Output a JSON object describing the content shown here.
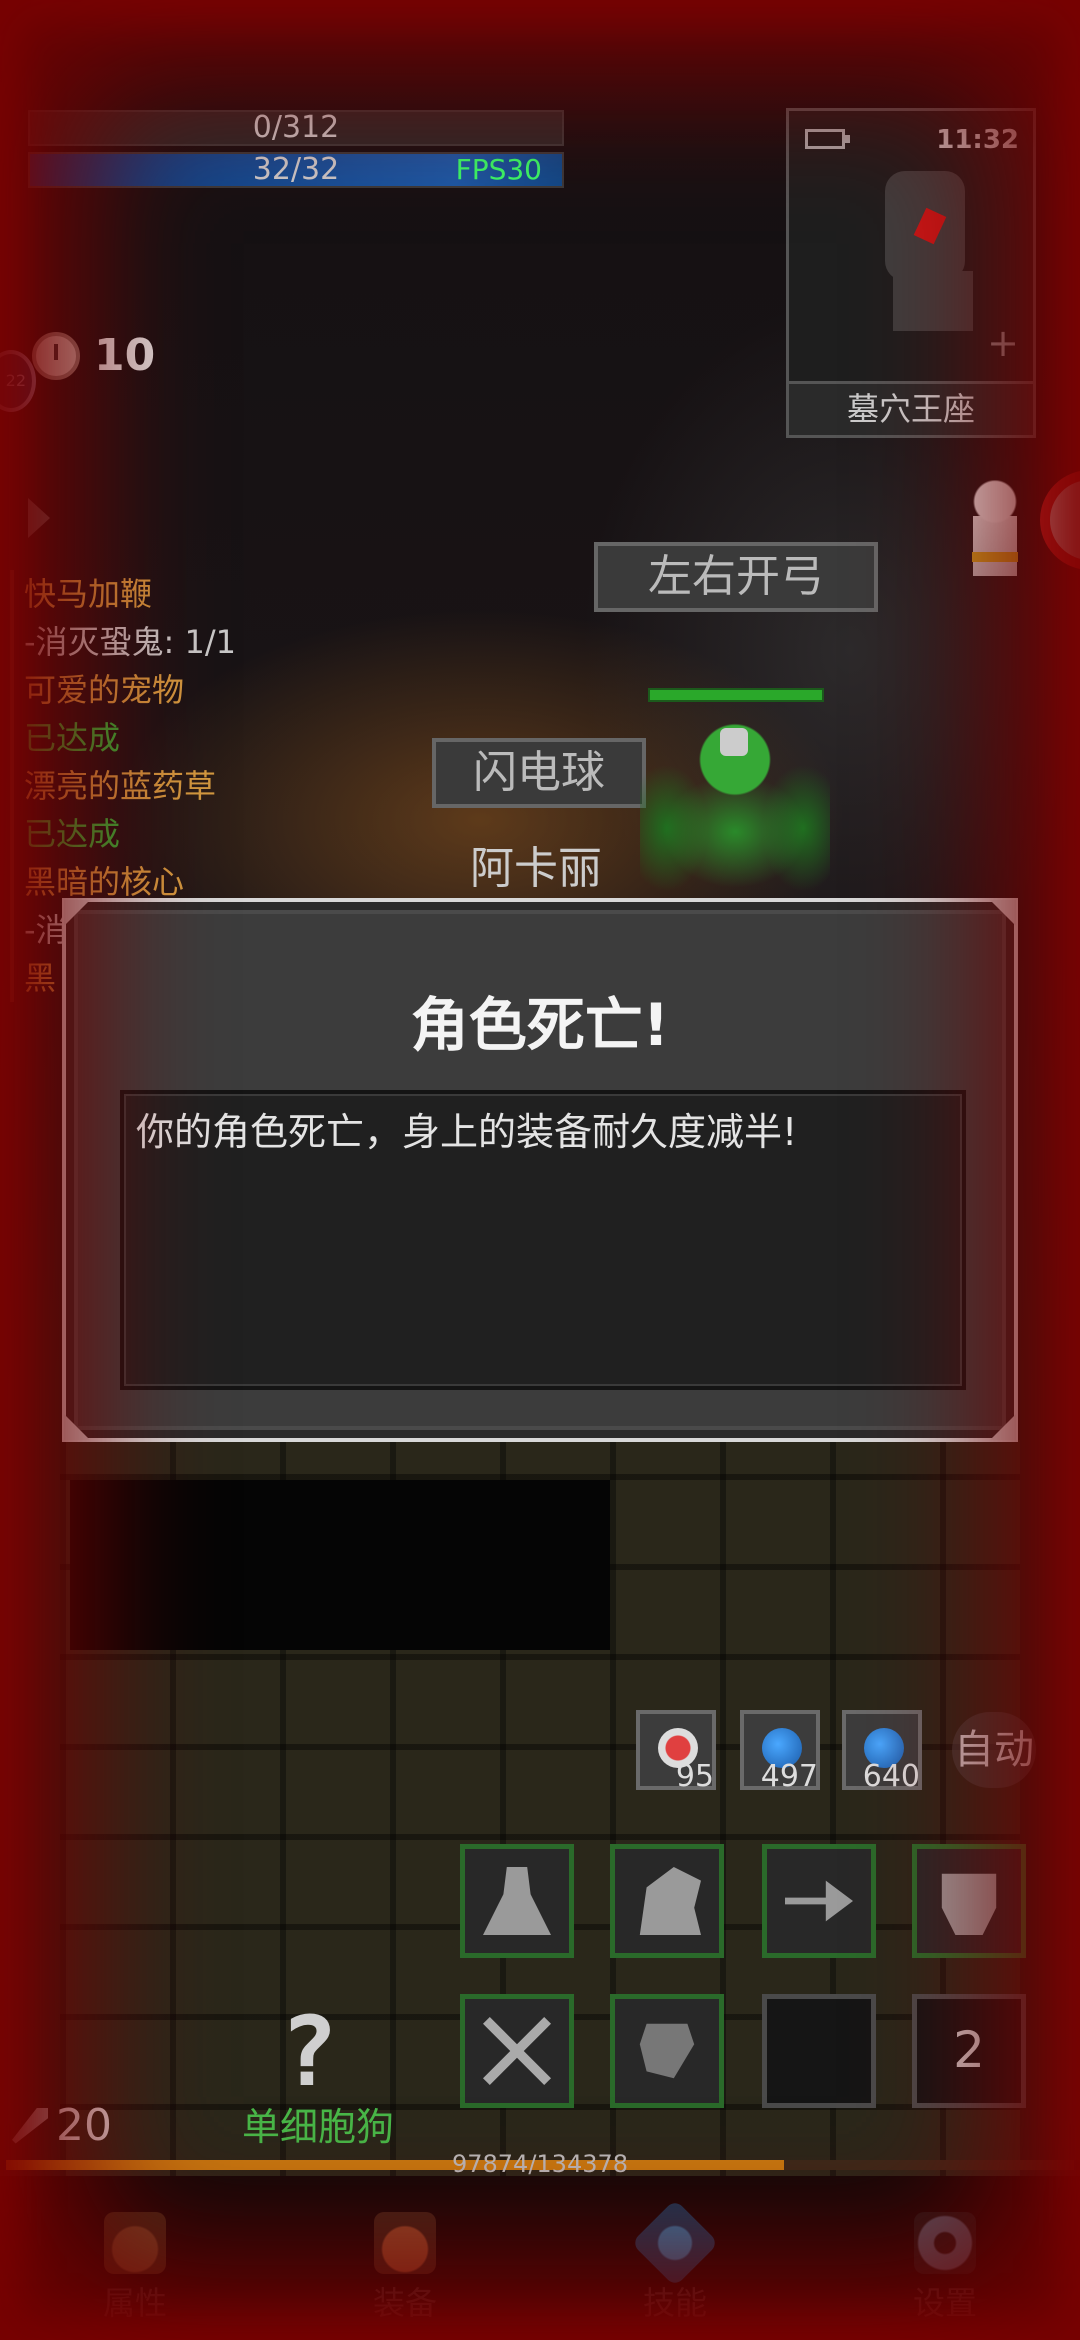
{
  "hud": {
    "hp_text": "0/312",
    "mp_text": "32/32",
    "fps_text": "FPS30"
  },
  "minimap": {
    "clock": "11:32",
    "location": "墓穴王座"
  },
  "timer": {
    "value": "10"
  },
  "level_badge": "22",
  "quests": [
    {
      "title": "快马加鞭",
      "status": "-消灭蛩鬼: 1/1",
      "status_type": "progress"
    },
    {
      "title": "可爱的宠物",
      "status": "已达成",
      "status_type": "done"
    },
    {
      "title": "漂亮的蓝药草",
      "status": "已达成",
      "status_type": "done"
    },
    {
      "title": "黑暗的核心",
      "status": "-消",
      "status_type": "progress"
    },
    {
      "title": "黑",
      "status": "",
      "status_type": "progress"
    }
  ],
  "scene_labels": {
    "skill_shout_1": "左右开弓",
    "skill_shout_2": "闪电球",
    "npc_name": "阿卡丽"
  },
  "dialog": {
    "title": "角色死亡!",
    "message": "你的角色死亡，身上的装备耐久度减半!"
  },
  "consumables": [
    {
      "name": "red-potion-icon",
      "count": "95"
    },
    {
      "name": "blue-gem-icon",
      "count": "497"
    },
    {
      "name": "blue-gem-icon",
      "count": "640"
    }
  ],
  "auto_label": "自动",
  "skill_page": "2",
  "pet": {
    "name": "单细胞狗"
  },
  "attack": "20",
  "xp": {
    "text": "97874/134378",
    "current": 97874,
    "max": 134378
  },
  "nav": [
    {
      "label": "属性",
      "icon": "helmet-icon"
    },
    {
      "label": "装备",
      "icon": "bag-icon"
    },
    {
      "label": "技能",
      "icon": "skill-crystal-icon"
    },
    {
      "label": "设置",
      "icon": "gear-icon"
    }
  ],
  "colors": {
    "quest_title": "#d39a40",
    "quest_done": "#2fb53a",
    "fps": "#38ff6a",
    "pet_name": "#48b848",
    "xp_fill": "#c87a10"
  }
}
